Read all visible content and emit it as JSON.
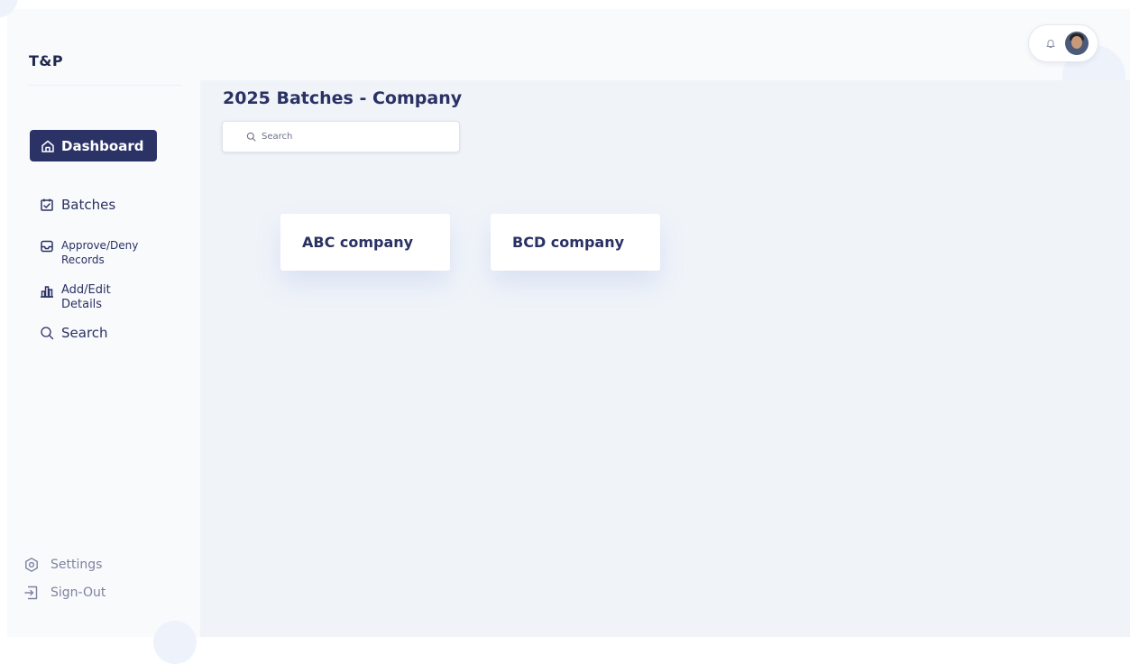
{
  "app": {
    "logo": "T&P"
  },
  "sidebar": {
    "items": [
      {
        "label": "Dashboard",
        "icon": "home-icon",
        "active": true
      },
      {
        "label": "Batches",
        "icon": "calendar-check-icon"
      },
      {
        "label": "Approve/Deny Records",
        "icon": "inbox-icon"
      },
      {
        "label": "Add/Edit Details",
        "icon": "bar-chart-icon"
      },
      {
        "label": "Search",
        "icon": "search-icon"
      }
    ],
    "bottom": [
      {
        "label": "Settings",
        "icon": "gear-icon"
      },
      {
        "label": "Sign-Out",
        "icon": "sign-out-icon"
      }
    ]
  },
  "header": {
    "notification_icon": "bell-icon",
    "avatar_icon": "user-avatar"
  },
  "main": {
    "title": "2025 Batches - Company",
    "search_placeholder": "Search",
    "companies": [
      {
        "name": "ABC company"
      },
      {
        "name": "BCD company"
      }
    ]
  },
  "colors": {
    "primary": "#2b3366",
    "background": "#f0f4f9",
    "sidebar_bg": "#f9fafc",
    "text": "#2a3163",
    "muted": "#7d83a0"
  }
}
